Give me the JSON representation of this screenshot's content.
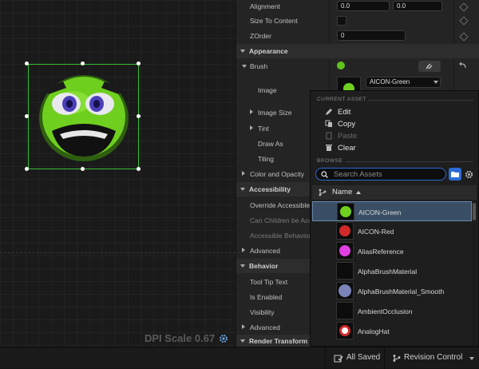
{
  "viewport": {
    "dpi_scale": "DPI Scale 0.67"
  },
  "details": {
    "rows": {
      "alignment": "Alignment",
      "alignment_x": "0.0",
      "alignment_y": "0.0",
      "size_to_content": "Size To Content",
      "zorder": "ZOrder",
      "zorder_value": "0"
    },
    "sections": {
      "appearance": "Appearance",
      "accessibility": "Accessibility",
      "behavior": "Behavior",
      "render_transform": "Render Transform"
    },
    "brush": "Brush",
    "image": "Image",
    "image_value": "AICON-Green",
    "image_size": "Image Size",
    "tint": "Tint",
    "draw_as": "Draw As",
    "tiling": "Tiling",
    "color_and_opacity": "Color and Opacity",
    "override_accessible": "Override Accessible De",
    "can_children": "Can Children be Access",
    "accessible_behavior": "Accessible Behavior",
    "advanced_1": "Advanced",
    "tool_tip_text": "Tool Tip Text",
    "is_enabled": "Is Enabled",
    "visibility": "Visibility",
    "advanced_2": "Advanced"
  },
  "picker": {
    "current_asset_caption": "CURRENT ASSET",
    "browse_caption": "BROWSE",
    "menu": {
      "edit": "Edit",
      "copy": "Copy",
      "paste": "Paste",
      "clear": "Clear"
    },
    "search_placeholder": "Search Assets",
    "column_name": "Name",
    "assets": [
      {
        "name": "AICON-Green",
        "selected": true
      },
      {
        "name": "AICON-Red",
        "selected": false
      },
      {
        "name": "AliasReference",
        "selected": false
      },
      {
        "name": "AlphaBrushMaterial",
        "selected": false
      },
      {
        "name": "AlphaBrushMaterial_Smooth",
        "selected": false
      },
      {
        "name": "AmbientOcclusion",
        "selected": false
      },
      {
        "name": "AnalogHat",
        "selected": false
      }
    ]
  },
  "bottombar": {
    "all_saved": "All Saved",
    "revision_control": "Revision Control"
  },
  "colors": {
    "selection_green": "#36c036",
    "accent_blue": "#2d6bd6",
    "selected_row": "#3a4f66"
  }
}
